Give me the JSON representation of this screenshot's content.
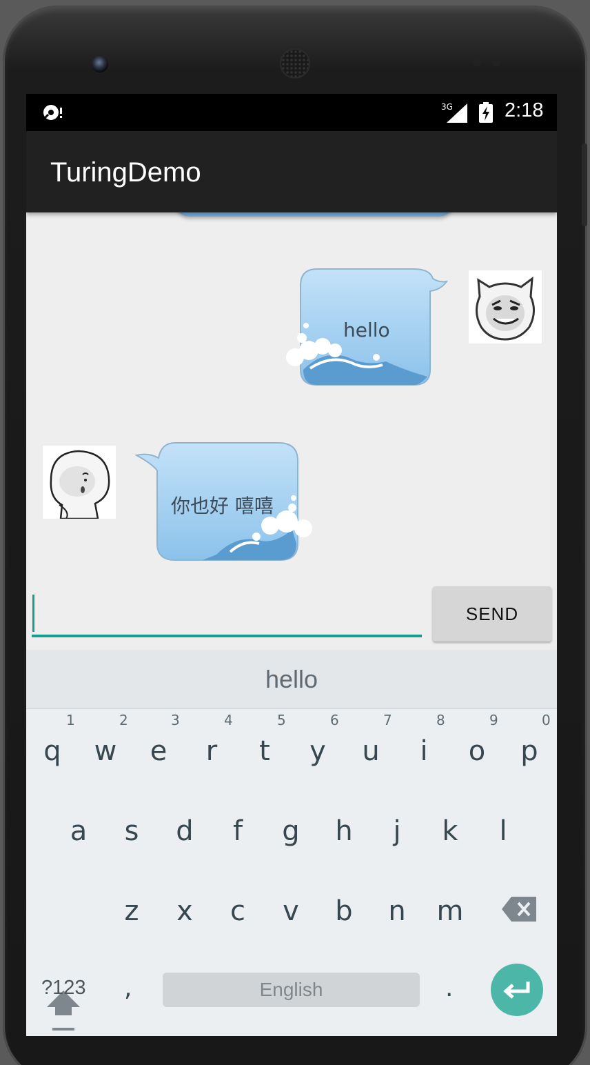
{
  "app": {
    "title": "TuringDemo"
  },
  "status_bar": {
    "time": "2:18",
    "network": "3G",
    "icons": [
      "debug-icon",
      "signal-icon",
      "battery-charging-icon"
    ]
  },
  "messages": [
    {
      "sender": "me",
      "text": "hello",
      "avatar": "laughing-meme-face"
    },
    {
      "sender": "bot",
      "text": "你也好 嘻嘻",
      "avatar": "round-head-meme-face"
    }
  ],
  "input": {
    "value": "",
    "send_label": "SEND"
  },
  "keyboard": {
    "suggestion": "hello",
    "row1": [
      "q",
      "w",
      "e",
      "r",
      "t",
      "y",
      "u",
      "i",
      "o",
      "p"
    ],
    "row1_hints": [
      "1",
      "2",
      "3",
      "4",
      "5",
      "6",
      "7",
      "8",
      "9",
      "0"
    ],
    "row2": [
      "a",
      "s",
      "d",
      "f",
      "g",
      "h",
      "j",
      "k",
      "l"
    ],
    "row3": [
      "z",
      "x",
      "c",
      "v",
      "b",
      "n",
      "m"
    ],
    "symbols_label": "?123",
    "comma": ",",
    "space_label": "English",
    "period": ".",
    "accent_color": "#4cb7a8"
  },
  "colors": {
    "appbar": "#212121",
    "accent": "#139e8e",
    "bubble": "#9fcdf1"
  }
}
